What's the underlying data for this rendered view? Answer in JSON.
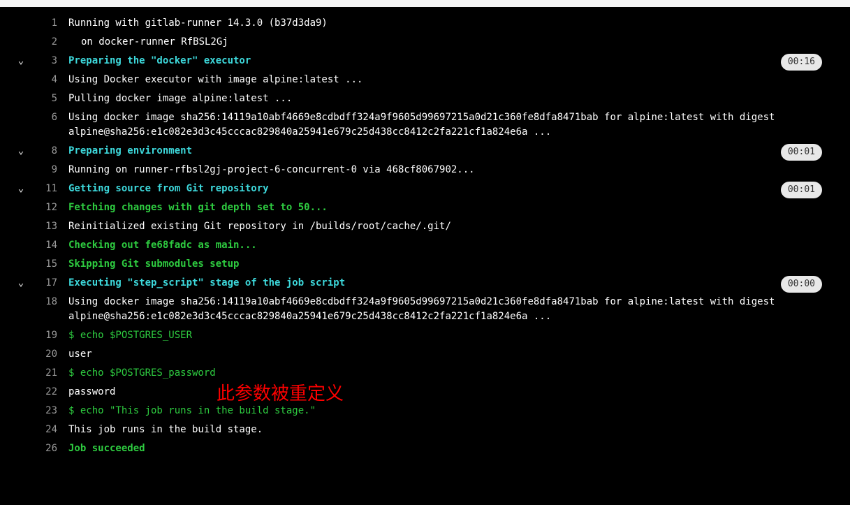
{
  "lines": [
    {
      "num": "1",
      "text": "Running with gitlab-runner 14.3.0 (b37d3da9)",
      "type": "plain",
      "collapse": false
    },
    {
      "num": "2",
      "text": "on docker-runner RfBSL2Gj",
      "type": "plain",
      "collapse": false,
      "indent": true
    },
    {
      "num": "3",
      "text": "Preparing the \"docker\" executor",
      "type": "section",
      "collapse": true,
      "time": "00:16"
    },
    {
      "num": "4",
      "text": "Using Docker executor with image alpine:latest ...",
      "type": "plain",
      "collapse": false
    },
    {
      "num": "5",
      "text": "Pulling docker image alpine:latest ...",
      "type": "plain",
      "collapse": false
    },
    {
      "num": "6",
      "text": "Using docker image sha256:14119a10abf4669e8cdbdff324a9f9605d99697215a0d21c360fe8dfa8471bab for alpine:latest with digest alpine@sha256:e1c082e3d3c45cccac829840a25941e679c25d438cc8412c2fa221cf1a824e6a ...",
      "type": "plain",
      "collapse": false
    },
    {
      "num": "8",
      "text": "Preparing environment",
      "type": "section",
      "collapse": true,
      "time": "00:01"
    },
    {
      "num": "9",
      "text": "Running on runner-rfbsl2gj-project-6-concurrent-0 via 468cf8067902...",
      "type": "plain",
      "collapse": false
    },
    {
      "num": "11",
      "text": "Getting source from Git repository",
      "type": "section",
      "collapse": true,
      "time": "00:01"
    },
    {
      "num": "12",
      "text": "Fetching changes with git depth set to 50...",
      "type": "green",
      "collapse": false
    },
    {
      "num": "13",
      "text": "Reinitialized existing Git repository in /builds/root/cache/.git/",
      "type": "plain",
      "collapse": false
    },
    {
      "num": "14",
      "text": "Checking out fe68fadc as main...",
      "type": "green",
      "collapse": false
    },
    {
      "num": "15",
      "text": "Skipping Git submodules setup",
      "type": "green",
      "collapse": false
    },
    {
      "num": "17",
      "text": "Executing \"step_script\" stage of the job script",
      "type": "section",
      "collapse": true,
      "time": "00:00"
    },
    {
      "num": "18",
      "text": "Using docker image sha256:14119a10abf4669e8cdbdff324a9f9605d99697215a0d21c360fe8dfa8471bab for alpine:latest with digest alpine@sha256:e1c082e3d3c45cccac829840a25941e679c25d438cc8412c2fa221cf1a824e6a ...",
      "type": "plain",
      "collapse": false
    },
    {
      "num": "19",
      "text": "$ echo $POSTGRES_USER",
      "type": "greencmd",
      "collapse": false
    },
    {
      "num": "20",
      "text": "user",
      "type": "plain",
      "collapse": false
    },
    {
      "num": "21",
      "text": "$ echo $POSTGRES_password",
      "type": "greencmd",
      "collapse": false
    },
    {
      "num": "22",
      "text": "password",
      "type": "plain",
      "collapse": false
    },
    {
      "num": "23",
      "text": "$ echo \"This job runs in the build stage.\"",
      "type": "greencmd",
      "collapse": false
    },
    {
      "num": "24",
      "text": "This job runs in the build stage.",
      "type": "plain",
      "collapse": false
    },
    {
      "num": "26",
      "text": "Job succeeded",
      "type": "green",
      "collapse": false
    }
  ],
  "annotation": "此参数被重定义",
  "collapse_glyph": "⌄"
}
